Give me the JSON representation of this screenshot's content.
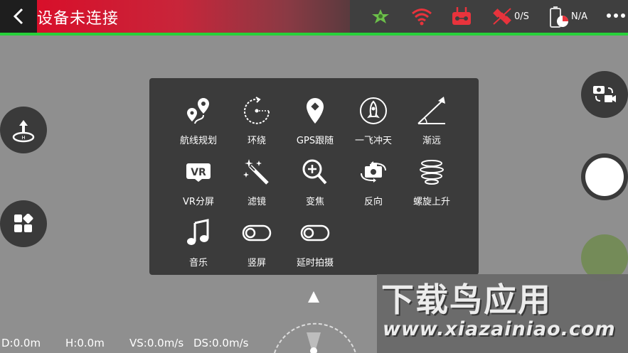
{
  "header": {
    "title": "设备未连接",
    "satellite_speed": "0/S",
    "battery_text": "N/A"
  },
  "colors": {
    "title_red": "#d80f2a",
    "connection_bar": "#27d13a",
    "signal_red": "#e8333c"
  },
  "menu": {
    "items": [
      {
        "label": "航线规划",
        "icon": "route-planning-icon"
      },
      {
        "label": "环绕",
        "icon": "orbit-icon"
      },
      {
        "label": "GPS跟随",
        "icon": "gps-follow-icon"
      },
      {
        "label": "一飞冲天",
        "icon": "rocket-icon"
      },
      {
        "label": "渐远",
        "icon": "dronie-icon"
      },
      {
        "label": "VR分屏",
        "icon": "vr-icon"
      },
      {
        "label": "滤镜",
        "icon": "filter-wand-icon"
      },
      {
        "label": "变焦",
        "icon": "zoom-icon"
      },
      {
        "label": "反向",
        "icon": "flip-camera-icon"
      },
      {
        "label": "螺旋上升",
        "icon": "spiral-icon"
      },
      {
        "label": "音乐",
        "icon": "music-icon"
      },
      {
        "label": "竖屏",
        "icon": "toggle-icon"
      },
      {
        "label": "延时拍摄",
        "icon": "toggle-icon"
      }
    ]
  },
  "telemetry": {
    "distance": "D:0.0m",
    "height": "H:0.0m",
    "vertical_speed": "VS:0.0m/s",
    "horizontal_speed": "DS:0.0m/s"
  },
  "watermark": {
    "line1": "下载鸟应用",
    "line2": "www.xiazainiao.com"
  }
}
